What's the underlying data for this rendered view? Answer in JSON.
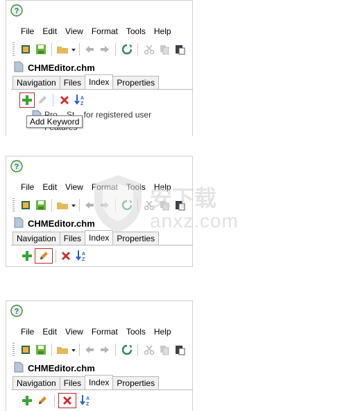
{
  "panels": [
    {
      "id": "panel-1",
      "menu": [
        "File",
        "Edit",
        "View",
        "Format",
        "Tools",
        "Help"
      ],
      "file_title": "CHMEditor.chm",
      "tabs": [
        "Navigation",
        "Files",
        "Index",
        "Properties"
      ],
      "active_tab": "Index",
      "highlighted_button": "add-keyword",
      "tree_partial": "Pro... St... for registered user",
      "tree_partial_2": "Features",
      "tooltip": "Add Keyword"
    },
    {
      "id": "panel-2",
      "menu": [
        "File",
        "Edit",
        "View",
        "Format",
        "Tools",
        "Help"
      ],
      "file_title": "CHMEditor.chm",
      "tabs": [
        "Navigation",
        "Files",
        "Index",
        "Properties"
      ],
      "active_tab": "Index",
      "highlighted_button": "edit-keyword"
    },
    {
      "id": "panel-3",
      "menu": [
        "File",
        "Edit",
        "View",
        "Format",
        "Tools",
        "Help"
      ],
      "file_title": "CHMEditor.chm",
      "tabs": [
        "Navigation",
        "Files",
        "Index",
        "Properties"
      ],
      "active_tab": "Index",
      "highlighted_button": "delete-keyword"
    }
  ],
  "watermark": {
    "brand_cn": "安下载",
    "brand_en": "anxz.com"
  },
  "colors": {
    "accent_highlight": "#c0282d",
    "add_green": "#3aa335",
    "delete_red": "#d22b2b",
    "sort_blue": "#2b63c5"
  }
}
